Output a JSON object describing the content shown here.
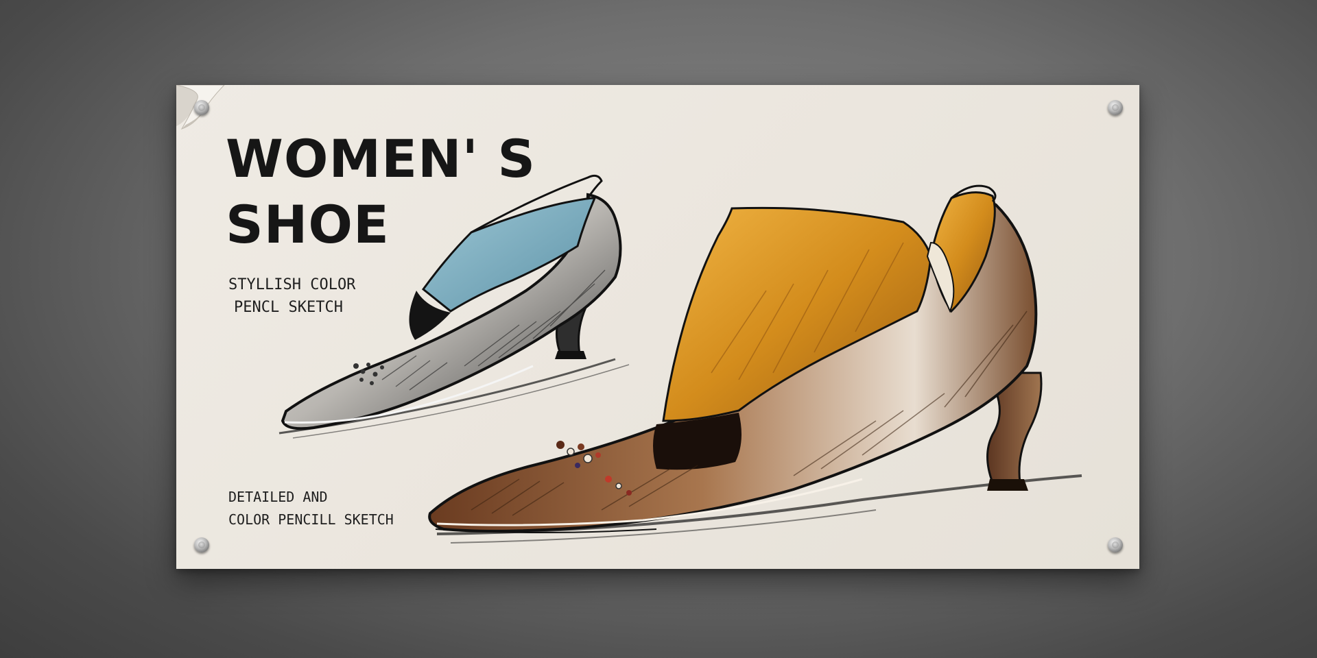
{
  "poster": {
    "title_line1": "WOMEN' S",
    "title_line2": "SHOE",
    "subtitle_line1": "STYLLISH COLOR",
    "subtitle_line2": "PENCL SKETCH",
    "footer_line1": "DETAILED  AND",
    "footer_line2": "COLOR PENCILL SKETCH"
  },
  "colors": {
    "background": "#6e6e6e",
    "paper": "#ebe6de",
    "text": "#161616",
    "blue_shoe_upper": "#7fb0c2",
    "gold_shoe_upper": "#d4901e",
    "brown_shoe": "#7a4a2c"
  },
  "icons": {
    "corner": "curled-corner-icon",
    "mount": "screw-icon"
  }
}
